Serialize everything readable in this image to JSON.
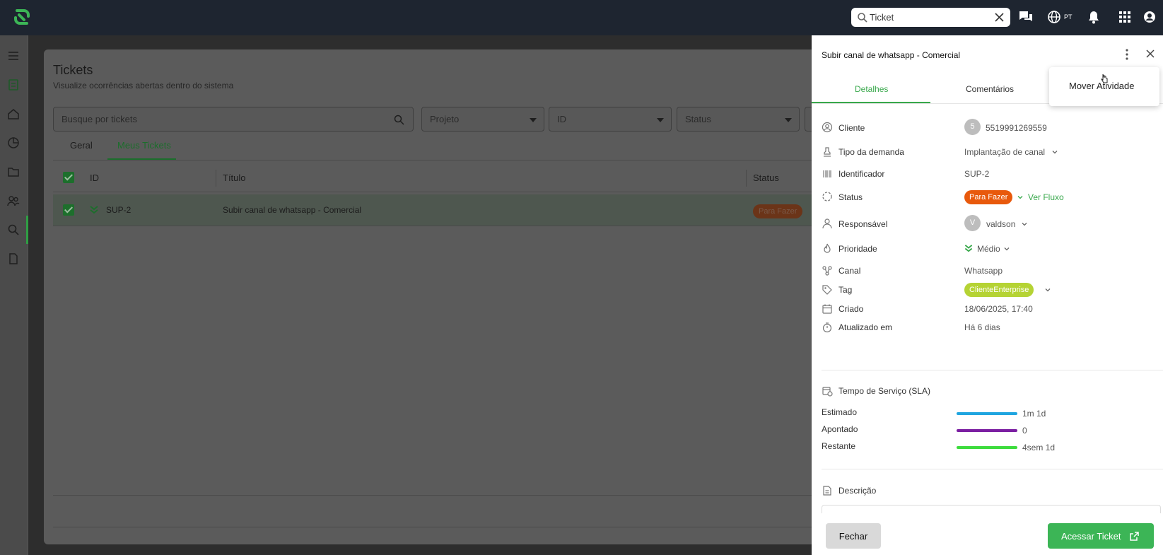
{
  "topbar": {
    "search_value": "Ticket",
    "language": "PT",
    "icons": [
      "app-logo-icon",
      "search-icon",
      "clear-icon",
      "chat-icon",
      "globe-icon",
      "bell-icon",
      "apps-grid-icon",
      "user-account-icon"
    ]
  },
  "sidebar": {
    "icons": [
      "menu-icon",
      "dashboard-icon",
      "home-icon",
      "reports-icon",
      "folder-icon",
      "users-icon",
      "search-icon",
      "document-icon"
    ],
    "active": "search-icon"
  },
  "page": {
    "title": "Tickets",
    "subtitle": "Visualize ocorrências abertas dentro do sistema",
    "search_placeholder": "Busque por tickets",
    "filters": [
      "Projeto",
      "ID",
      "Status"
    ],
    "tabs": [
      "Geral",
      "Meus Tickets"
    ],
    "active_tab": "Meus Tickets",
    "columns": [
      "ID",
      "Título",
      "Status"
    ],
    "rows": [
      {
        "id": "SUP-2",
        "title": "Subir canal de whatsapp - Comercial",
        "status": "Para Fazer"
      }
    ]
  },
  "drawer": {
    "title": "Subir canal de whatsapp - Comercial",
    "tabs": [
      "Detalhes",
      "Comentários"
    ],
    "active_tab": "Detalhes",
    "menu_item": "Mover Atividade",
    "details": {
      "cliente_label": "Cliente",
      "cliente_avatar": "5",
      "cliente_value": "5519991269559",
      "tipo_label": "Tipo da demanda",
      "tipo_value": "Implantação de canal",
      "identificador_label": "Identificador",
      "identificador_value": "SUP-2",
      "status_label": "Status",
      "status_value": "Para Fazer",
      "status_link": "Ver Fluxo",
      "responsavel_label": "Responsável",
      "responsavel_avatar": "V",
      "responsavel_value": "valdson",
      "prioridade_label": "Prioridade",
      "prioridade_value": "Médio",
      "canal_label": "Canal",
      "canal_value": "Whatsapp",
      "tag_label": "Tag",
      "tag_value": "ClienteEnterprise",
      "criado_label": "Criado",
      "criado_value": "18/06/2025, 17:40",
      "atualizado_label": "Atualizado em",
      "atualizado_value": "Há 6 dias"
    },
    "sla": {
      "title": "Tempo de Serviço (SLA)",
      "estimado_label": "Estimado",
      "estimado_value": "1m 1d",
      "apontado_label": "Apontado",
      "apontado_value": "0",
      "restante_label": "Restante",
      "restante_value": "4sem 1d"
    },
    "description_label": "Descrição",
    "close_button": "Fechar",
    "access_button": "Acessar Ticket"
  },
  "colors": {
    "topbar": "#1e2530",
    "brand_green": "#3cb556",
    "status_orange": "#e8590c",
    "tag_lime": "#b5d334",
    "sla_estimado": "#1fa5e0",
    "sla_apontado": "#7b1fa2",
    "sla_restante": "#3ddc3d"
  }
}
